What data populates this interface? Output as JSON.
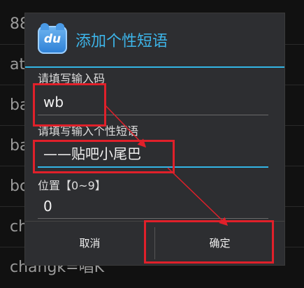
{
  "background_list": [
    "88",
    "at",
    "ba",
    "ba",
    "bc",
    "chang",
    "changk=唱K"
  ],
  "dialog": {
    "icon_label": "du",
    "title": "添加个性短语",
    "code_label": "请填写输入码",
    "code_value": "wb",
    "phrase_label": "请填写输入个性短语",
    "phrase_value": "——贴吧小尾巴",
    "position_label": "位置【0~9】",
    "position_value": "0",
    "cancel_label": "取消",
    "confirm_label": "确定"
  },
  "colors": {
    "accent": "#33b5e5",
    "annotation": "#e0202a",
    "dialog_bg": "#2d2e31"
  }
}
